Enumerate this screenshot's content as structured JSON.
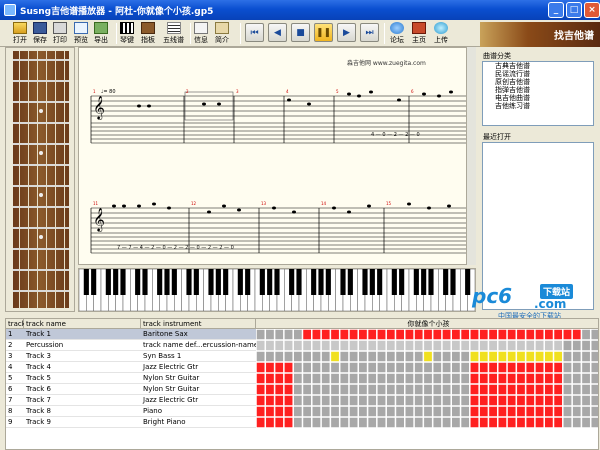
{
  "window": {
    "title": "Susng吉他谱播放器 - 阿杜-你就像个小孩.gp5"
  },
  "toolbar": {
    "buttons": [
      {
        "label": "打开",
        "icon": "open-icon"
      },
      {
        "label": "保存",
        "icon": "save-icon"
      },
      {
        "label": "打印",
        "icon": "print-icon"
      },
      {
        "label": "预览",
        "icon": "preview-icon"
      },
      {
        "label": "导出",
        "icon": "export-icon"
      },
      {
        "label": "琴键",
        "icon": "piano-icon"
      },
      {
        "label": "指板",
        "icon": "fretboard-icon"
      },
      {
        "label": "五线谱",
        "icon": "staff-icon"
      },
      {
        "label": "信息",
        "icon": "info-icon"
      },
      {
        "label": "简介",
        "icon": "intro-icon"
      }
    ],
    "right_buttons": [
      {
        "label": "论坛",
        "icon": "forum-icon"
      },
      {
        "label": "主页",
        "icon": "home-icon"
      },
      {
        "label": "上传",
        "icon": "upload-icon"
      }
    ],
    "banner": "找吉他谱"
  },
  "score": {
    "site": "淼吉他网 www.zuegita.com",
    "tempo": "♩= 80",
    "measure_numbers": [
      "1",
      "2",
      "3",
      "4",
      "5",
      "6",
      "11",
      "12",
      "13",
      "14",
      "15",
      "16"
    ],
    "tab_row1": "4 — 0 — 2 — 2 — 0",
    "tab_row2": "7 — 7 — 4 — 2 — 0 — 2 — 2 — 0 — 2 — 2 — 0"
  },
  "right_panel": {
    "category_title": "曲谱分类",
    "categories": [
      "古典吉他谱",
      "民谣流行谱",
      "原创吉他谱",
      "指弹吉他谱",
      "电吉他曲谱",
      "吉他练习谱"
    ],
    "recent_title": "最近打开"
  },
  "watermark": {
    "logo": "pc6",
    "tld": ".com",
    "tag": "下载站",
    "slogan": "中国最安全的下载站"
  },
  "tracks": {
    "headers": {
      "num": "track",
      "name": "track name",
      "instrument": "track instrument"
    },
    "song_title": "你就像个小孩",
    "rows": [
      {
        "num": "1",
        "name": "Track 1",
        "instrument": "Baritone Sax"
      },
      {
        "num": "2",
        "name": "Percussion",
        "instrument": "track name def...ercussion-name"
      },
      {
        "num": "3",
        "name": "Track 3",
        "instrument": "Syn Bass 1"
      },
      {
        "num": "4",
        "name": "Track 4",
        "instrument": "Jazz Electric Gtr"
      },
      {
        "num": "5",
        "name": "Track 5",
        "instrument": "Nylon Str Guitar"
      },
      {
        "num": "6",
        "name": "Track 6",
        "instrument": "Nylon Str Guitar"
      },
      {
        "num": "7",
        "name": "Track 7",
        "instrument": "Jazz Electric Gtr"
      },
      {
        "num": "8",
        "name": "Track 8",
        "instrument": "Piano"
      },
      {
        "num": "9",
        "name": "Track 9",
        "instrument": "Bright Piano"
      }
    ]
  },
  "colors": {
    "accent": "#0a4fd0",
    "track_active": "#ff2020",
    "track_empty": "#a8a8a8",
    "track_bass": "#f0e020"
  }
}
